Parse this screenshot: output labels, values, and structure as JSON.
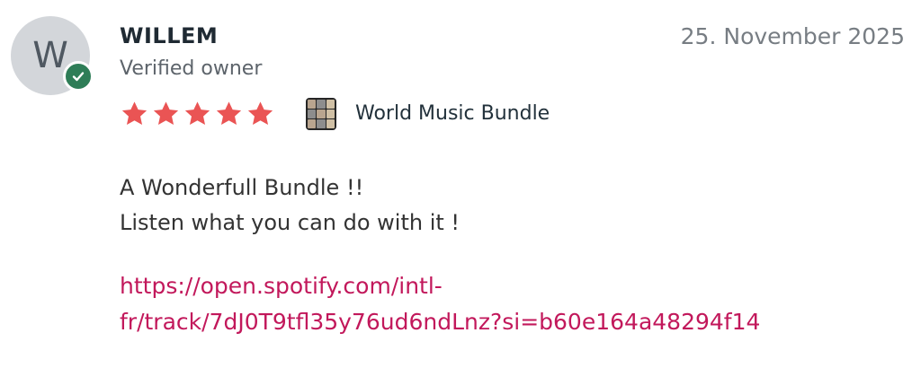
{
  "review": {
    "avatar_initial": "W",
    "author": "WILLEM",
    "verified_label": "Verified owner",
    "date": "25. November 2025",
    "rating": 5,
    "rating_max": 5,
    "product_name": "World Music Bundle",
    "body_lines": [
      "A Wonderfull Bundle !!",
      "Listen what you can do with it !"
    ],
    "link_lines": [
      "https://open.spotify.com/intl-",
      "fr/track/7dJ0T9tfl35y76ud6ndLnz?si=b60e164a48294f14"
    ]
  },
  "colors": {
    "star": "#ea5454",
    "verified_badge": "#2e7d57",
    "link": "#c2185b"
  },
  "icons": {
    "star": "star-icon",
    "verified": "check-icon",
    "product": "product-thumbnail"
  }
}
